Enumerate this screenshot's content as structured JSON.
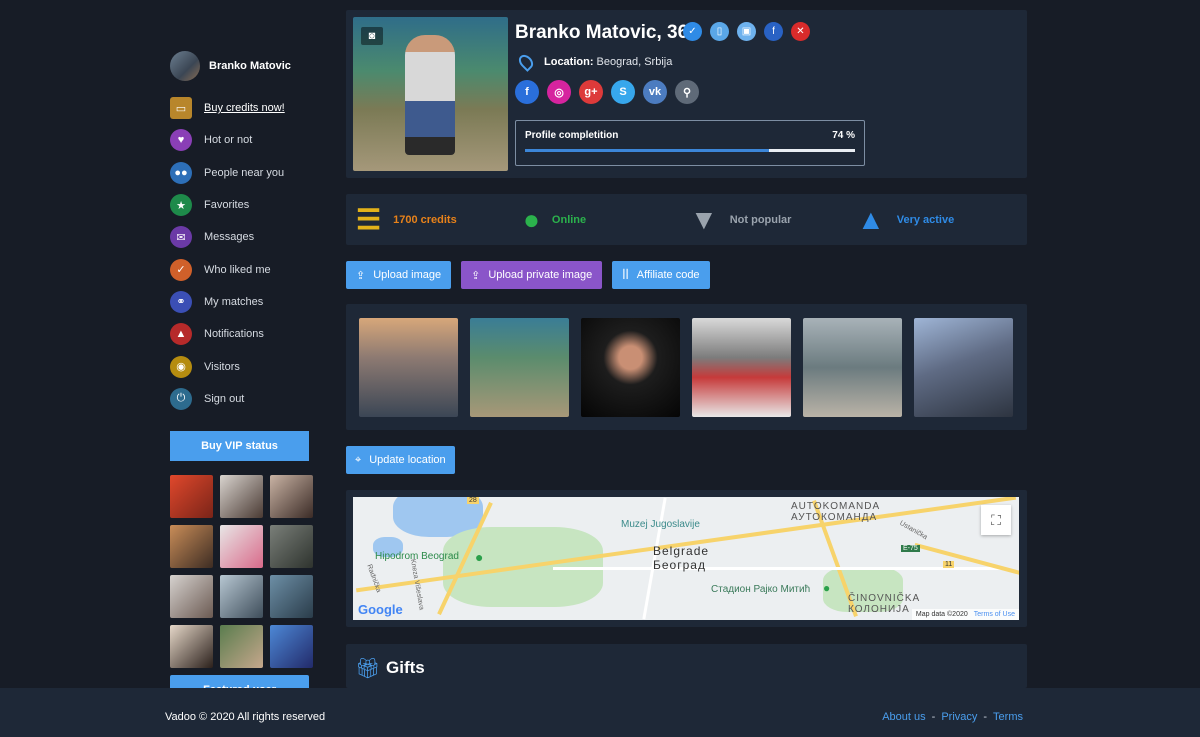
{
  "sidebar": {
    "user_name": "Branko Matovic",
    "menu": [
      {
        "label": "Buy credits now!",
        "icon": "wallet-icon",
        "color": "#b8862b",
        "glyph": "▭"
      },
      {
        "label": "Hot or not",
        "icon": "heart-icon",
        "color": "#8a3fb6",
        "glyph": "♥"
      },
      {
        "label": "People near you",
        "icon": "people-icon",
        "color": "#2d6fb8",
        "glyph": "●"
      },
      {
        "label": "Favorites",
        "icon": "star-icon",
        "color": "#1e8a4a",
        "glyph": "★"
      },
      {
        "label": "Messages",
        "icon": "chat-icon",
        "color": "#6b3aa6",
        "glyph": "✉"
      },
      {
        "label": "Who liked me",
        "icon": "thumbs-up-icon",
        "color": "#d0602a",
        "glyph": "👍"
      },
      {
        "label": "My matches",
        "icon": "couple-icon",
        "color": "#3b4fb5",
        "glyph": "⚭"
      },
      {
        "label": "Notifications",
        "icon": "bell-icon",
        "color": "#b62a2a",
        "glyph": "🔔"
      },
      {
        "label": "Visitors",
        "icon": "eye-icon",
        "color": "#b58c10",
        "glyph": "◉"
      },
      {
        "label": "Sign out",
        "icon": "power-icon",
        "color": "#2d6b8e",
        "glyph": "⏻"
      }
    ],
    "vip_label": "Buy VIP status",
    "featured_label": "Featured user"
  },
  "profile": {
    "name": "Branko Matovic, 36",
    "location_label": "Location:",
    "location_value": "Beograd, Srbija",
    "completion_label": "Profile completition",
    "completion_pct": "74 %",
    "completion_value": 74
  },
  "stats": {
    "credits": "1700 credits",
    "online": "Online",
    "popularity": "Not popular",
    "activity": "Very active"
  },
  "buttons": {
    "upload": "Upload image",
    "upload_private": "Upload private image",
    "affiliate": "Affiliate code",
    "update_location": "Update location"
  },
  "map": {
    "labels": {
      "autokomanda_lat": "AUTOKOMANDA",
      "autokomanda_cyr": "АУТОКОМАНДА",
      "muzej": "Muzej Jugoslavije",
      "hipodrom": "Hipodrom Beograd",
      "belgrade_lat": "Belgrade",
      "belgrade_cyr": "Београд",
      "stadion": "Стадион Рајко Митић",
      "cinovnicka_lat": "ČINOVNIČKA",
      "cinovnicka_cyr": "КОЛОНИЈА",
      "ustanicka": "Ustanička",
      "radnicka": "Radnička",
      "kneza": "Kneza Višeslava",
      "e75": "E-75",
      "route11": "11",
      "route28": "28"
    },
    "google": "Google",
    "data_text": "Map data ©2020",
    "terms": "Terms of Use"
  },
  "gifts_title": "Gifts",
  "footer": {
    "copyright": "Vadoo © 2020 All rights reserved",
    "about": "About us",
    "privacy": "Privacy",
    "terms": "Terms"
  }
}
